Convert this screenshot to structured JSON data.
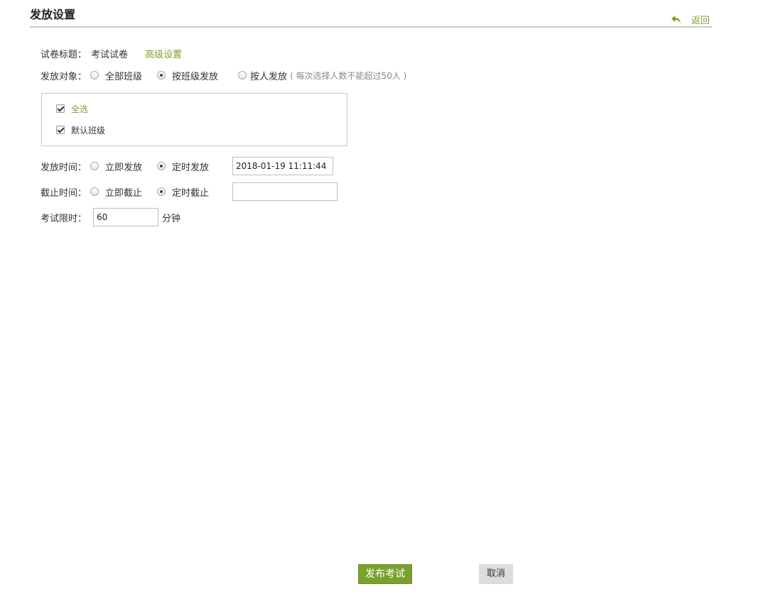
{
  "header": {
    "title": "发放设置",
    "back_label": "返回"
  },
  "form": {
    "paper_title": {
      "label": "试卷标题：",
      "value": "考试试卷",
      "advanced_link": "高级设置"
    },
    "target": {
      "label": "发放对象：",
      "options": [
        "全部班级",
        "按班级发放",
        "按人发放"
      ],
      "selected": "按班级发放",
      "hint": "( 每次选择人数不能超过50人 )"
    },
    "classes": {
      "select_all": {
        "label": "全选",
        "checked": true
      },
      "items": [
        {
          "label": "默认班级",
          "checked": true
        }
      ]
    },
    "release_time": {
      "label": "发放时间：",
      "options": [
        "立即发放",
        "定时发放"
      ],
      "selected": "定时发放",
      "value": "2018-01-19 11:11:44"
    },
    "deadline": {
      "label": "截止时间：",
      "options": [
        "立即截止",
        "定时截止"
      ],
      "selected": "定时截止",
      "value": ""
    },
    "time_limit": {
      "label": "考试限时：",
      "value": "60",
      "unit": "分钟"
    }
  },
  "footer": {
    "publish_label": "发布考试",
    "cancel_label": "取消"
  },
  "colors": {
    "accent": "#7aa12d",
    "divider": "#c8c8c8"
  }
}
